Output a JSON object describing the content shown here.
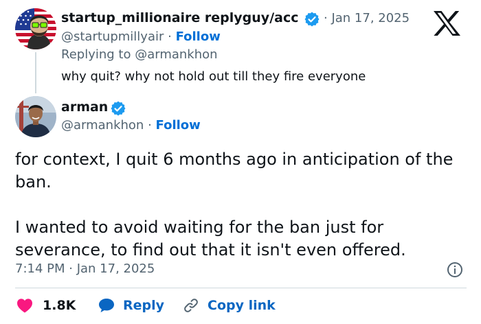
{
  "parent_tweet": {
    "display_name": "startup_millionaire replyguy/acc",
    "date": "· Jan 17, 2025",
    "handle": "@startupmillyair",
    "separator": " · ",
    "follow_label": "Follow",
    "replying_to": "Replying to @armankhon",
    "text": "why quit? why not hold out till they fire everyone"
  },
  "main_tweet": {
    "display_name": "arman",
    "handle": "@armankhon",
    "separator": " · ",
    "follow_label": "Follow",
    "paragraphs": [
      "for context, I quit 6 months ago in anticipation of the ban.",
      "I wanted to avoid waiting for the ban just for severance, to find out that it isn't even offered."
    ],
    "timestamp": "7:14 PM · Jan 17, 2025"
  },
  "actions": {
    "like_count": "1.8K",
    "reply_label": "Reply",
    "copy_label": "Copy link"
  },
  "icons": {
    "platform_logo": "x-logo-icon",
    "verified": "verified-badge-icon",
    "info": "info-icon",
    "like": "heart-icon",
    "reply": "speech-bubble-icon",
    "copy": "link-icon"
  },
  "colors": {
    "verified_blue": "#1d9bf0",
    "follow_blue": "#006fd6",
    "action_blue": "#0a66c2",
    "like_red": "#f91880",
    "secondary_text": "#536471",
    "divider": "#cfd9de"
  }
}
